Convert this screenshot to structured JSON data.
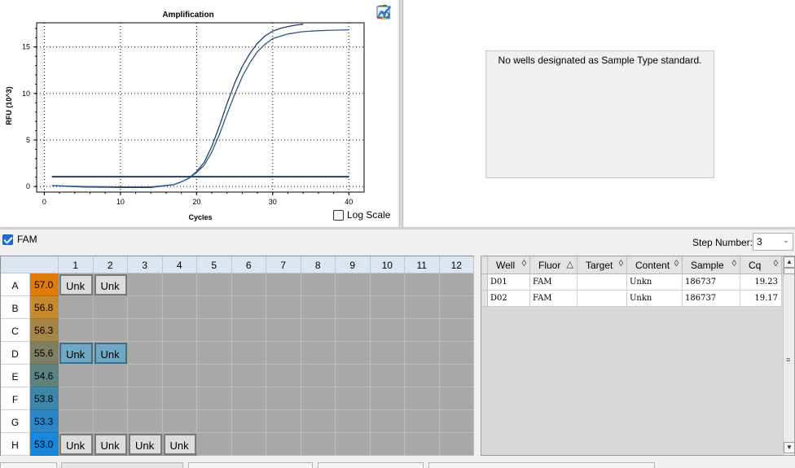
{
  "chart_data": {
    "type": "line",
    "title": "Amplification",
    "xlabel": "Cycles",
    "ylabel": "RFU (10^3)",
    "xlim": [
      -1,
      42
    ],
    "ylim": [
      -0.6,
      17.6
    ],
    "xticks": [
      0,
      10,
      20,
      30,
      40
    ],
    "yticks": [
      0,
      5,
      10,
      15
    ],
    "grid": true,
    "series": [
      {
        "x": [
          1,
          5,
          10,
          14,
          17,
          18,
          19,
          20,
          21,
          22,
          23,
          24,
          25,
          26,
          27,
          28,
          29,
          30,
          31,
          32,
          33,
          34
        ],
        "y": [
          0.1,
          -0.05,
          -0.1,
          -0.1,
          0.2,
          0.5,
          0.9,
          1.6,
          2.6,
          4.3,
          6.5,
          8.9,
          11.1,
          12.9,
          14.3,
          15.4,
          16.2,
          16.7,
          17.0,
          17.2,
          17.35,
          17.45
        ]
      },
      {
        "x": [
          1,
          5,
          10,
          14,
          17,
          18,
          19,
          20,
          21,
          22,
          23,
          24,
          25,
          26,
          27,
          28,
          29,
          30,
          32,
          34,
          36,
          38,
          40
        ],
        "y": [
          0.1,
          0.0,
          -0.05,
          -0.05,
          0.2,
          0.5,
          0.9,
          1.5,
          2.3,
          3.7,
          5.6,
          7.8,
          9.9,
          11.8,
          13.3,
          14.5,
          15.3,
          15.9,
          16.4,
          16.65,
          16.75,
          16.8,
          16.85
        ]
      },
      {
        "x": [
          1,
          40
        ],
        "y": [
          1.05,
          1.05
        ]
      }
    ],
    "series_colors": [
      "#1f3f6b",
      "#2a5a8c",
      "#1f3f6b"
    ]
  },
  "toolbar_icons": [
    "copy-icon",
    "export-icon",
    "refresh-chart-icon",
    "zoom-chart-icon",
    "chart-options-icon"
  ],
  "log_scale_label": "Log Scale",
  "standard_curve_message": "No wells designated as Sample Type standard.",
  "fluor_checkbox_label": "FAM",
  "step_number_label": "Step Number:",
  "step_number_value": "3",
  "plate": {
    "columns": [
      "1",
      "2",
      "3",
      "4",
      "5",
      "6",
      "7",
      "8",
      "9",
      "10",
      "11",
      "12"
    ],
    "rows": [
      {
        "label": "A",
        "temp": "57.0",
        "temp_color": "#e07a0b",
        "wells": [
          "Unk",
          "Unk",
          "",
          "",
          "",
          "",
          "",
          "",
          "",
          "",
          "",
          ""
        ]
      },
      {
        "label": "B",
        "temp": "56.8",
        "temp_color": "#c78a2c",
        "wells": [
          "",
          "",
          "",
          "",
          "",
          "",
          "",
          "",
          "",
          "",
          "",
          ""
        ]
      },
      {
        "label": "C",
        "temp": "56.3",
        "temp_color": "#a58648",
        "wells": [
          "",
          "",
          "",
          "",
          "",
          "",
          "",
          "",
          "",
          "",
          "",
          ""
        ]
      },
      {
        "label": "D",
        "temp": "55.6",
        "temp_color": "#7f8063",
        "wells": [
          "Unk",
          "Unk",
          "",
          "",
          "",
          "",
          "",
          "",
          "",
          "",
          "",
          ""
        ]
      },
      {
        "label": "E",
        "temp": "54.6",
        "temp_color": "#5d8280",
        "wells": [
          "",
          "",
          "",
          "",
          "",
          "",
          "",
          "",
          "",
          "",
          "",
          ""
        ]
      },
      {
        "label": "F",
        "temp": "53.8",
        "temp_color": "#3d86a8",
        "wells": [
          "",
          "",
          "",
          "",
          "",
          "",
          "",
          "",
          "",
          "",
          "",
          ""
        ]
      },
      {
        "label": "G",
        "temp": "53.3",
        "temp_color": "#2a86c6",
        "wells": [
          "",
          "",
          "",
          "",
          "",
          "",
          "",
          "",
          "",
          "",
          "",
          ""
        ]
      },
      {
        "label": "H",
        "temp": "53.0",
        "temp_color": "#1a86da",
        "wells": [
          "Unk",
          "Unk",
          "Unk",
          "Unk",
          "",
          "",
          "",
          "",
          "",
          "",
          "",
          ""
        ]
      }
    ],
    "selected_row": "D"
  },
  "results_table": {
    "headers": [
      "Well",
      "Fluor",
      "Target",
      "Content",
      "Sample",
      "Cq"
    ],
    "sort_glyphs": [
      "◊",
      "△",
      "◊",
      "◊",
      "◊",
      "◊"
    ],
    "rows": [
      [
        "D01",
        "FAM",
        "",
        "Unkn",
        "186737",
        "19.23"
      ],
      [
        "D02",
        "FAM",
        "",
        "Unkn",
        "186737",
        "19.17"
      ]
    ]
  }
}
